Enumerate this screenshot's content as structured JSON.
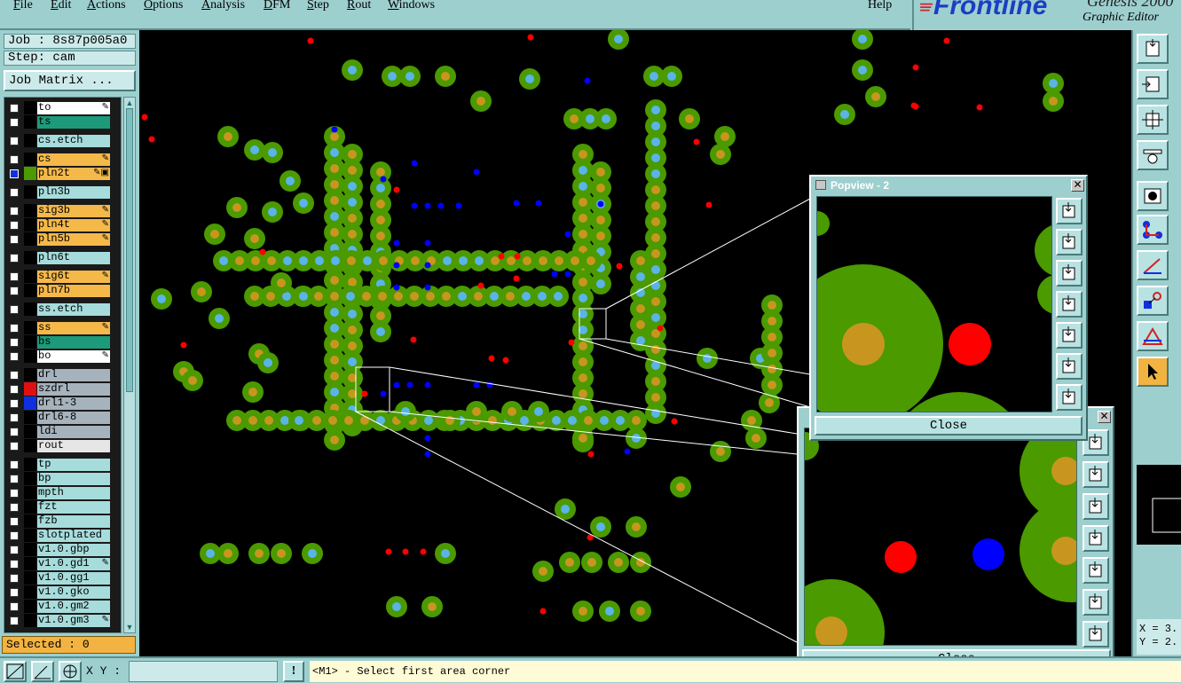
{
  "menubar": {
    "items": [
      {
        "label": "File",
        "u": "F"
      },
      {
        "label": "Edit",
        "u": "E"
      },
      {
        "label": "Actions",
        "u": "A"
      },
      {
        "label": "Options",
        "u": "O"
      },
      {
        "label": "Analysis",
        "u": "A"
      },
      {
        "label": "DFM",
        "u": "D"
      },
      {
        "label": "Step",
        "u": "S"
      },
      {
        "label": "Rout",
        "u": "R"
      },
      {
        "label": "Windows",
        "u": "W"
      }
    ],
    "help": "Help"
  },
  "brand": {
    "logo": "Frontline",
    "product": "Genesis 2000",
    "subtitle": "Graphic Editor"
  },
  "left_panel": {
    "job": "Job : 8s87p005a0",
    "step": "Step: cam",
    "job_matrix_button": "Job Matrix ...",
    "selected": "Selected : 0",
    "layers": [
      {
        "name": "to",
        "color": "#ffffff",
        "swatch": "#000000",
        "flag": "edit"
      },
      {
        "name": "ts",
        "color": "#1d9a7a",
        "swatch": "#000000",
        "flag": ""
      },
      {
        "name": "cs.etch",
        "color": "#a7dcdc",
        "swatch": "#000000",
        "flag": ""
      },
      {
        "name": "cs",
        "color": "#f5b94a",
        "swatch": "#000000",
        "flag": "edit"
      },
      {
        "name": "pln2t",
        "color": "#f5b94a",
        "swatch": "#4a9a00",
        "flag": "work",
        "selected": true
      },
      {
        "name": "pln3b",
        "color": "#a7dcdc",
        "swatch": "#000000",
        "flag": ""
      },
      {
        "name": "sig3b",
        "color": "#f5b94a",
        "swatch": "#000000",
        "flag": "edit"
      },
      {
        "name": "pln4t",
        "color": "#f5b94a",
        "swatch": "#000000",
        "flag": "edit"
      },
      {
        "name": "pln5b",
        "color": "#f5b94a",
        "swatch": "#000000",
        "flag": "edit"
      },
      {
        "name": "pln6t",
        "color": "#a7dcdc",
        "swatch": "#000000",
        "flag": ""
      },
      {
        "name": "sig6t",
        "color": "#f5b94a",
        "swatch": "#000000",
        "flag": "edit"
      },
      {
        "name": "pln7b",
        "color": "#f5b94a",
        "swatch": "#000000",
        "flag": ""
      },
      {
        "name": "ss.etch",
        "color": "#a7dcdc",
        "swatch": "#000000",
        "flag": ""
      },
      {
        "name": "ss",
        "color": "#f5b94a",
        "swatch": "#000000",
        "flag": "edit"
      },
      {
        "name": "bs",
        "color": "#1d9a7a",
        "swatch": "#000000",
        "flag": ""
      },
      {
        "name": "bo",
        "color": "#ffffff",
        "swatch": "#000000",
        "flag": "edit"
      },
      {
        "name": "drl",
        "color": "#a6b3bd",
        "swatch": "#000000",
        "flag": ""
      },
      {
        "name": "szdrl",
        "color": "#a6b3bd",
        "swatch": "#e01010",
        "flag": ""
      },
      {
        "name": "drl1-3",
        "color": "#a6b3bd",
        "swatch": "#1030e0",
        "flag": ""
      },
      {
        "name": "drl6-8",
        "color": "#a6b3bd",
        "swatch": "#000000",
        "flag": ""
      },
      {
        "name": "ldi",
        "color": "#a6b3bd",
        "swatch": "#000000",
        "flag": ""
      },
      {
        "name": "rout",
        "color": "#e6e6e6",
        "swatch": "#000000",
        "flag": ""
      },
      {
        "name": "tp",
        "color": "#a7dcdc",
        "swatch": "#000000",
        "flag": ""
      },
      {
        "name": "bp",
        "color": "#a7dcdc",
        "swatch": "#000000",
        "flag": ""
      },
      {
        "name": "mpth",
        "color": "#a7dcdc",
        "swatch": "#000000",
        "flag": ""
      },
      {
        "name": "fzt",
        "color": "#a7dcdc",
        "swatch": "#000000",
        "flag": ""
      },
      {
        "name": "fzb",
        "color": "#a7dcdc",
        "swatch": "#000000",
        "flag": ""
      },
      {
        "name": "slotplated",
        "color": "#a7dcdc",
        "swatch": "#000000",
        "flag": ""
      },
      {
        "name": "v1.0.gbp",
        "color": "#a7dcdc",
        "swatch": "#000000",
        "flag": ""
      },
      {
        "name": "v1.0.gd1",
        "color": "#a7dcdc",
        "swatch": "#000000",
        "flag": "edit"
      },
      {
        "name": "v1.0.gg1",
        "color": "#a7dcdc",
        "swatch": "#000000",
        "flag": ""
      },
      {
        "name": "v1.0.gko",
        "color": "#a7dcdc",
        "swatch": "#000000",
        "flag": ""
      },
      {
        "name": "v1.0.gm2",
        "color": "#a7dcdc",
        "swatch": "#000000",
        "flag": ""
      },
      {
        "name": "v1.0.gm3",
        "color": "#a7dcdc",
        "swatch": "#000000",
        "flag": "edit"
      }
    ]
  },
  "colors": {
    "pad_green": "#4a9a00",
    "pad_center_amber": "#c8961e",
    "pad_center_cyan": "#5ab4e8",
    "via_red": "#ff0000",
    "via_blue": "#0000ff",
    "title_active": "#000080"
  },
  "popview2": {
    "title": "Popview - 2",
    "close_label": "Close"
  },
  "popview1": {
    "title": "",
    "close_label": "Close"
  },
  "popview_tool_icons": [
    "zoom-in-icon",
    "zoom-home-icon",
    "zoom-fit-icon",
    "pan-left-icon",
    "pan-right-icon",
    "fit-all-icon",
    "center-icon"
  ],
  "right_tools": {
    "icons": [
      "zoom-window-icon",
      "pan-icon",
      "fit-icon",
      "measure-icon",
      "select-icon",
      "connect-icon",
      "line-icon",
      "snap-icon",
      "triangle-icon",
      "pointer-icon"
    ],
    "coords": {
      "x": "X = 3.",
      "y": "Y = 2."
    }
  },
  "statusbar": {
    "xy_label": "X Y :",
    "xy_value": "",
    "alert": "!",
    "prompt": "<M1> - Select first area corner"
  }
}
